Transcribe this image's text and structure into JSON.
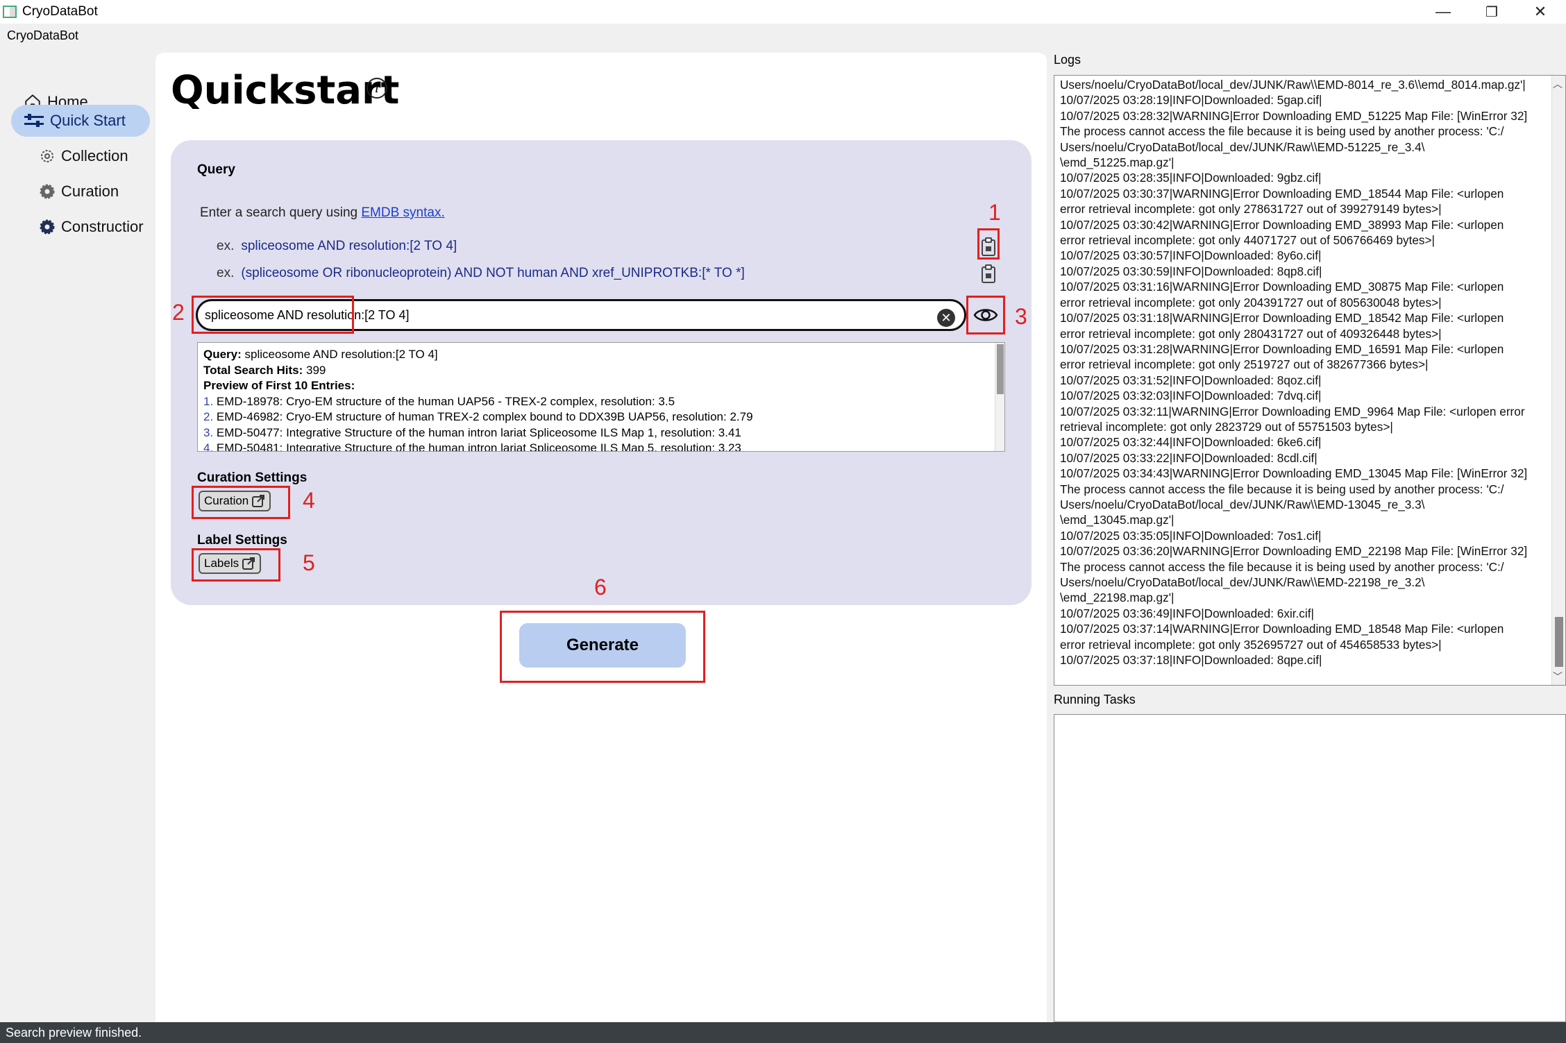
{
  "window": {
    "title": "CryoDataBot",
    "menu_label": "CryoDataBot",
    "minimize": "—",
    "restore": "❐",
    "close": "✕"
  },
  "sidebar": {
    "items": [
      {
        "label": "Home",
        "icon": "home-icon"
      },
      {
        "label": "Quick Start",
        "icon": "sliders-icon",
        "active": true
      },
      {
        "label": "Collection",
        "icon": "gear-outline-icon"
      },
      {
        "label": "Curation",
        "icon": "gear-icon"
      },
      {
        "label": "Constructior",
        "icon": "gear-solid-icon"
      }
    ]
  },
  "main": {
    "title": "Quickstart",
    "info_symbol": "i",
    "query_section": "Query",
    "hint_prefix": "Enter a search query using ",
    "hint_link": "EMDB syntax.",
    "examples": [
      {
        "prefix": "ex.",
        "query": "spliceosome AND resolution:[2 TO 4]"
      },
      {
        "prefix": "ex.",
        "query": "(spliceosome OR ribonucleoprotein) AND NOT human AND xref_UNIPROTKB:[* TO *]"
      }
    ],
    "search_value": "spliceosome AND resolution:[2 TO 4]",
    "clear_symbol": "✕",
    "preview": {
      "query_label": "Query:",
      "query_value": "spliceosome AND resolution:[2 TO 4]",
      "hits_label": "Total Search Hits:",
      "hits_value": "399",
      "preview_heading": "Preview of First 10 Entries:",
      "entries": [
        {
          "n": "1.",
          "text": "EMD-18978: Cryo-EM structure of the human UAP56 - TREX-2 complex, resolution: 3.5"
        },
        {
          "n": "2.",
          "text": "EMD-46982: Cryo-EM structure of human TREX-2 complex bound to DDX39B UAP56, resolution: 2.79"
        },
        {
          "n": "3.",
          "text": "EMD-50477: Integrative Structure of the human intron lariat Spliceosome ILS Map 1, resolution: 3.41"
        },
        {
          "n": "4.",
          "text": "EMD-50481: Integrative Structure of the human intron lariat Spliceosome ILS Map 5, resolution: 3.23"
        }
      ]
    },
    "curation_section": "Curation Settings",
    "curation_button": "Curation",
    "label_section": "Label Settings",
    "labels_button": "Labels",
    "generate_button": "Generate",
    "annotations": [
      "1",
      "2",
      "3",
      "4",
      "5",
      "6"
    ]
  },
  "logs": {
    "label": "Logs",
    "lines": [
      "Users/noelu/CryoDataBot/local_dev/JUNK/Raw\\\\EMD-8014_re_3.6\\\\emd_8014.map.gz'|",
      "10/07/2025 03:28:19|INFO|Downloaded: 5gap.cif|",
      "10/07/2025 03:28:32|WARNING|Error Downloading EMD_51225 Map File: [WinError 32]",
      "The process cannot access the file because it is being used by another process: 'C:/",
      "Users/noelu/CryoDataBot/local_dev/JUNK/Raw\\\\EMD-51225_re_3.4\\",
      "\\emd_51225.map.gz'|",
      "10/07/2025 03:28:35|INFO|Downloaded: 9gbz.cif|",
      "10/07/2025 03:30:37|WARNING|Error Downloading EMD_18544 Map File: <urlopen",
      "error retrieval incomplete: got only 278631727 out of 399279149 bytes>|",
      "10/07/2025 03:30:42|WARNING|Error Downloading EMD_38993 Map File: <urlopen",
      "error retrieval incomplete: got only 44071727 out of 506766469 bytes>|",
      "10/07/2025 03:30:57|INFO|Downloaded: 8y6o.cif|",
      "10/07/2025 03:30:59|INFO|Downloaded: 8qp8.cif|",
      "10/07/2025 03:31:16|WARNING|Error Downloading EMD_30875 Map File: <urlopen",
      "error retrieval incomplete: got only 204391727 out of 805630048 bytes>|",
      "10/07/2025 03:31:18|WARNING|Error Downloading EMD_18542 Map File: <urlopen",
      "error retrieval incomplete: got only 280431727 out of 409326448 bytes>|",
      "10/07/2025 03:31:28|WARNING|Error Downloading EMD_16591 Map File: <urlopen",
      "error retrieval incomplete: got only 2519727 out of 382677366 bytes>|",
      "10/07/2025 03:31:52|INFO|Downloaded: 8qoz.cif|",
      "10/07/2025 03:32:03|INFO|Downloaded: 7dvq.cif|",
      "10/07/2025 03:32:11|WARNING|Error Downloading EMD_9964 Map File: <urlopen error",
      "retrieval incomplete: got only 2823729 out of 55751503 bytes>|",
      "10/07/2025 03:32:44|INFO|Downloaded: 6ke6.cif|",
      "10/07/2025 03:33:22|INFO|Downloaded: 8cdl.cif|",
      "10/07/2025 03:34:43|WARNING|Error Downloading EMD_13045 Map File: [WinError 32]",
      "The process cannot access the file because it is being used by another process: 'C:/",
      "Users/noelu/CryoDataBot/local_dev/JUNK/Raw\\\\EMD-13045_re_3.3\\",
      "\\emd_13045.map.gz'|",
      "10/07/2025 03:35:05|INFO|Downloaded: 7os1.cif|",
      "10/07/2025 03:36:20|WARNING|Error Downloading EMD_22198 Map File: [WinError 32]",
      "The process cannot access the file because it is being used by another process: 'C:/",
      "Users/noelu/CryoDataBot/local_dev/JUNK/Raw\\\\EMD-22198_re_3.2\\",
      "\\emd_22198.map.gz'|",
      "10/07/2025 03:36:49|INFO|Downloaded: 6xir.cif|",
      "10/07/2025 03:37:14|WARNING|Error Downloading EMD_18548 Map File: <urlopen",
      "error retrieval incomplete: got only 352695727 out of 454658533 bytes>|",
      "10/07/2025 03:37:18|INFO|Downloaded: 8qpe.cif|"
    ]
  },
  "running_tasks": {
    "label": "Running Tasks"
  },
  "status": {
    "text": "Search preview finished."
  },
  "colors": {
    "accent_active": "#bcd2f2",
    "card_bg": "#e0dfef",
    "generate_bg": "#b8cdf0",
    "annotation_red": "#e02020",
    "link": "#1a3fd0",
    "statusbar_bg": "#3a3f44"
  }
}
